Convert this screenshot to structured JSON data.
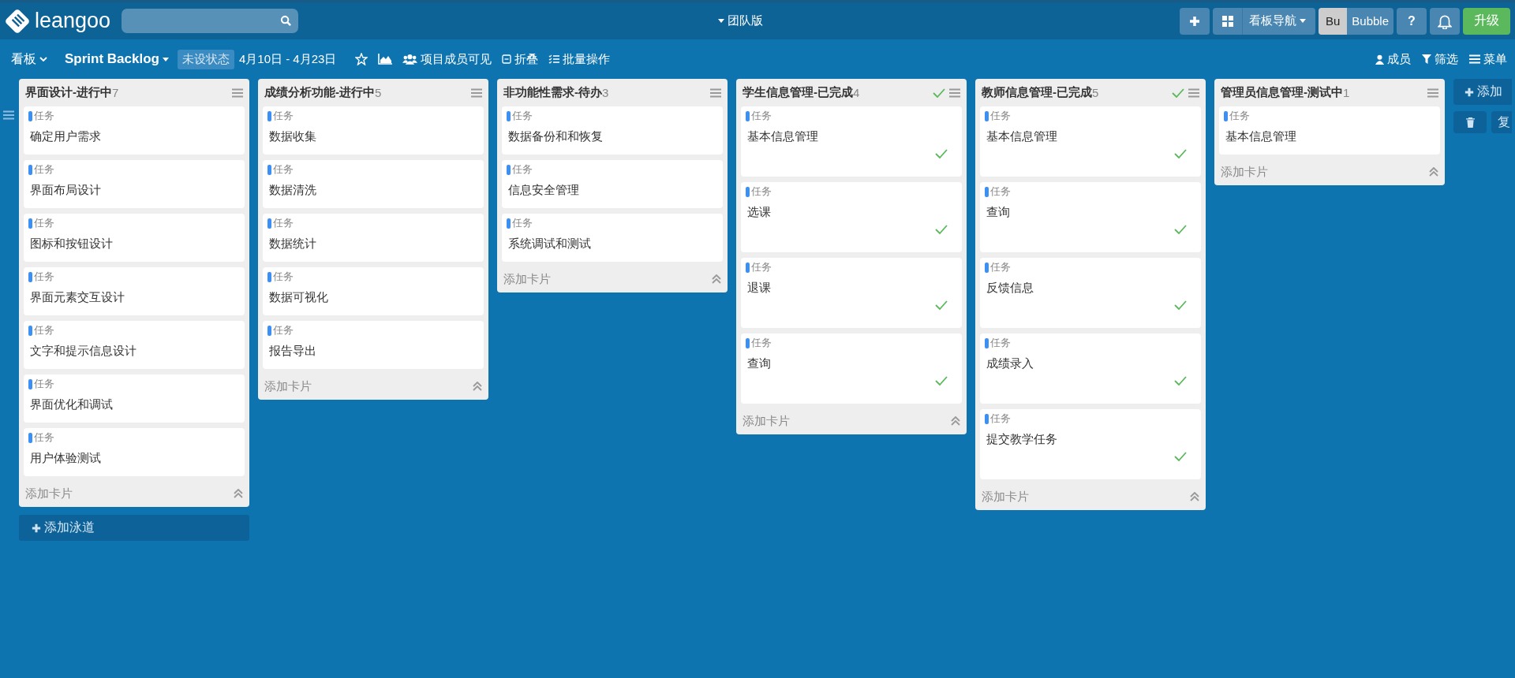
{
  "topbar": {
    "logo": "leangoo",
    "edition": "团队版",
    "board_nav": "看板导航",
    "bubble_short": "Bu",
    "bubble": "Bubble",
    "upgrade": "升级",
    "help": "?"
  },
  "toolbar": {
    "board_menu": "看板",
    "board_name": "Sprint Backlog",
    "status": "未设状态",
    "dates": "4月10日 - 4月23日",
    "actions": [
      {
        "kind": "star"
      },
      {
        "kind": "chart"
      },
      {
        "kind": "members",
        "label": "项目成员可见"
      },
      {
        "kind": "fold",
        "label": "折叠"
      },
      {
        "kind": "batch",
        "label": "批量操作"
      }
    ],
    "right": [
      {
        "kind": "members",
        "label": "成员"
      },
      {
        "kind": "filter",
        "label": "筛选"
      },
      {
        "kind": "menu",
        "label": "菜单"
      }
    ]
  },
  "lists": [
    {
      "title": "界面设计-进行中",
      "count": "7",
      "done": false,
      "add_card": "添加卡片",
      "cards": [
        {
          "type": "任务",
          "title": "确定用户需求",
          "done": false
        },
        {
          "type": "任务",
          "title": "界面布局设计",
          "done": false
        },
        {
          "type": "任务",
          "title": "图标和按钮设计",
          "done": false
        },
        {
          "type": "任务",
          "title": "界面元素交互设计",
          "done": false
        },
        {
          "type": "任务",
          "title": "文字和提示信息设计",
          "done": false
        },
        {
          "type": "任务",
          "title": "界面优化和调试",
          "done": false
        },
        {
          "type": "任务",
          "title": "用户体验测试",
          "done": false
        }
      ]
    },
    {
      "title": "成绩分析功能-进行中",
      "count": "5",
      "done": false,
      "add_card": "添加卡片",
      "cards": [
        {
          "type": "任务",
          "title": "数据收集",
          "done": false
        },
        {
          "type": "任务",
          "title": "数据清洗",
          "done": false
        },
        {
          "type": "任务",
          "title": "数据统计",
          "done": false
        },
        {
          "type": "任务",
          "title": "数据可视化",
          "done": false
        },
        {
          "type": "任务",
          "title": "报告导出",
          "done": false
        }
      ]
    },
    {
      "title": "非功能性需求-待办",
      "count": "3",
      "done": false,
      "add_card": "添加卡片",
      "cards": [
        {
          "type": "任务",
          "title": "数据备份和和恢复",
          "done": false
        },
        {
          "type": "任务",
          "title": "信息安全管理",
          "done": false
        },
        {
          "type": "任务",
          "title": "系统调试和测试",
          "done": false
        }
      ]
    },
    {
      "title": "学生信息管理-已完成",
      "count": "4",
      "done": true,
      "add_card": "添加卡片",
      "cards": [
        {
          "type": "任务",
          "title": "基本信息管理",
          "done": true
        },
        {
          "type": "任务",
          "title": "选课",
          "done": true
        },
        {
          "type": "任务",
          "title": "退课",
          "done": true
        },
        {
          "type": "任务",
          "title": "查询",
          "done": true
        }
      ]
    },
    {
      "title": "教师信息管理-已完成",
      "count": "5",
      "done": true,
      "add_card": "添加卡片",
      "cards": [
        {
          "type": "任务",
          "title": "基本信息管理",
          "done": true
        },
        {
          "type": "任务",
          "title": "查询",
          "done": true
        },
        {
          "type": "任务",
          "title": "反馈信息",
          "done": true
        },
        {
          "type": "任务",
          "title": "成绩录入",
          "done": true
        },
        {
          "type": "任务",
          "title": "提交教学任务",
          "done": true
        }
      ]
    },
    {
      "title": "管理员信息管理-测试中",
      "count": "1",
      "done": false,
      "add_card": "添加卡片",
      "cards": [
        {
          "type": "任务",
          "title": "基本信息管理",
          "done": false
        }
      ]
    }
  ],
  "add_lane": "添加泳道",
  "side_actions": {
    "add_list": "添加",
    "copy": "复"
  }
}
